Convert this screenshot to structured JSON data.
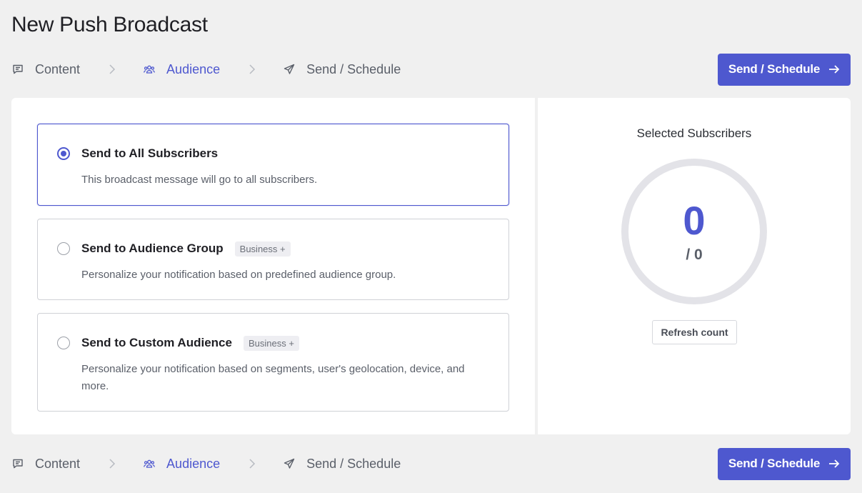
{
  "page": {
    "title": "New Push Broadcast"
  },
  "steps": {
    "content_label": "Content",
    "audience_label": "Audience",
    "send_label": "Send / Schedule"
  },
  "actions": {
    "send_schedule_label": "Send / Schedule"
  },
  "audience_options": [
    {
      "title": "Send to All Subscribers",
      "badge": "",
      "description": "This broadcast message will go to all subscribers.",
      "selected": true
    },
    {
      "title": "Send to Audience Group",
      "badge": "Business +",
      "description": "Personalize your notification based on predefined audience group.",
      "selected": false
    },
    {
      "title": "Send to Custom Audience",
      "badge": "Business +",
      "description": "Personalize your notification based on segments, user's geolocation, device, and more.",
      "selected": false
    }
  ],
  "subscribers": {
    "title": "Selected Subscribers",
    "count": "0",
    "total": "/ 0",
    "refresh_label": "Refresh count"
  },
  "colors": {
    "accent": "#4e58cf",
    "background": "#f0f0f0"
  }
}
